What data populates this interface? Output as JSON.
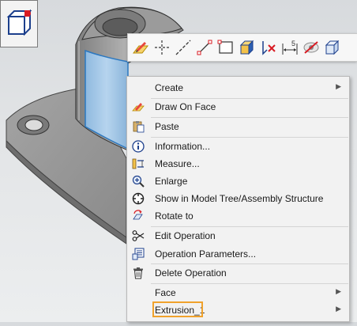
{
  "toolbar": {
    "items": [
      {
        "icon": "draw-on-face-icon"
      },
      {
        "icon": "cross-point-icon"
      },
      {
        "icon": "dashed-line-icon"
      },
      {
        "icon": "line-segment-icon"
      },
      {
        "icon": "rectangle-icon"
      },
      {
        "icon": "solid-box-icon"
      },
      {
        "icon": "delete-edge-icon"
      },
      {
        "icon": "dimension-icon",
        "label": "5"
      },
      {
        "icon": "hide-icon"
      },
      {
        "icon": "view-cube-icon"
      }
    ]
  },
  "menu": {
    "items": [
      {
        "label": "Create",
        "icon": "",
        "submenu": true
      },
      {
        "label": "Draw On Face",
        "icon": "draw-on-face-icon"
      },
      {
        "label": "Paste",
        "icon": "paste-icon"
      },
      {
        "label": "Information...",
        "icon": "info-icon"
      },
      {
        "label": "Measure...",
        "icon": "measure-icon"
      },
      {
        "label": "Enlarge",
        "icon": "zoom-icon"
      },
      {
        "label": "Show in Model Tree/Assembly Structure",
        "icon": "locate-icon"
      },
      {
        "label": "Rotate to",
        "icon": "rotate-to-icon"
      },
      {
        "label": "Edit Operation",
        "icon": "scissors-icon"
      },
      {
        "label": "Operation Parameters...",
        "icon": "parameters-icon"
      },
      {
        "label": "Delete Operation",
        "icon": "trash-icon"
      },
      {
        "label": "Face",
        "icon": "",
        "submenu": true
      },
      {
        "label": "Extrusion_1",
        "icon": "",
        "submenu": true
      }
    ]
  },
  "colors": {
    "highlight": "#f0a22c",
    "selected_face": "#9cc3e4",
    "model_gray": "#8e8e8e"
  }
}
